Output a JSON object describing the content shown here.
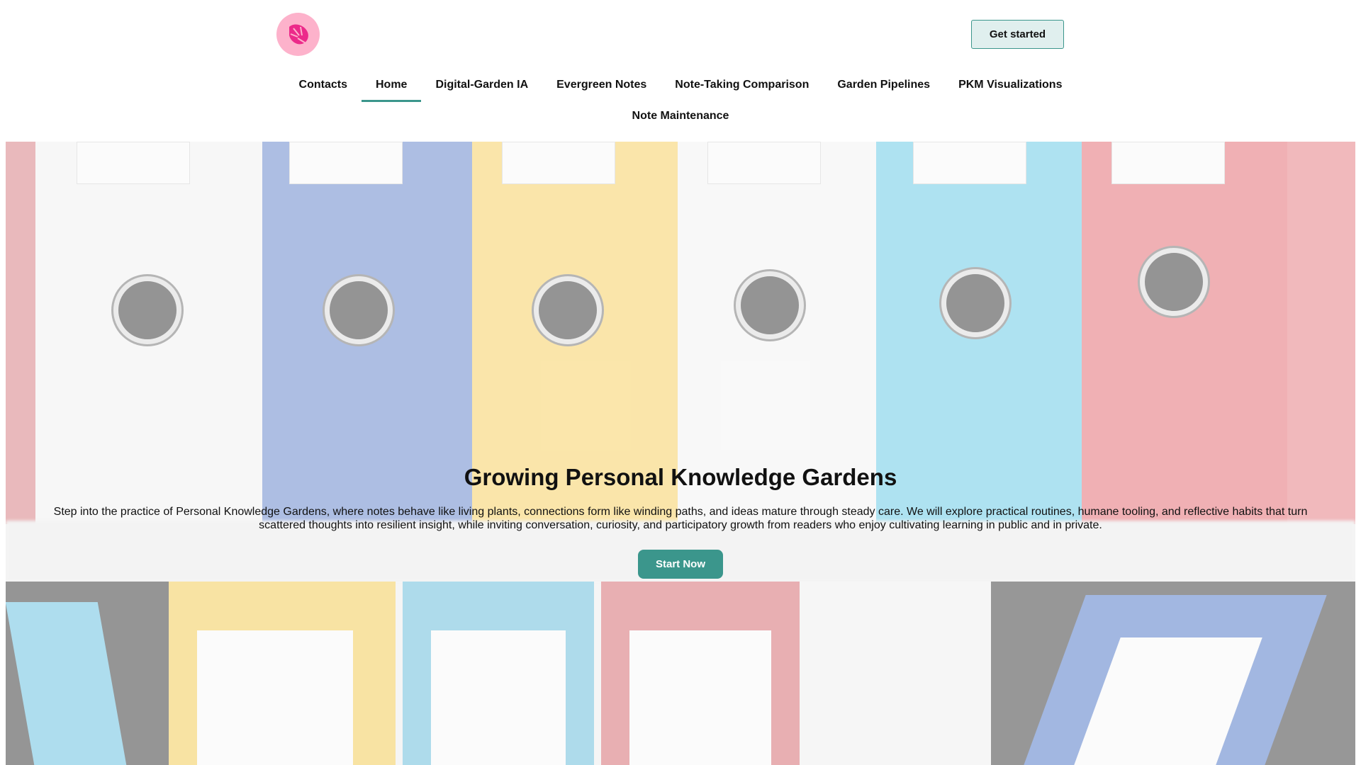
{
  "header": {
    "logo_icon": "monstera-leaf-icon",
    "cta_label": "Get started"
  },
  "nav": {
    "items": [
      {
        "label": "Contacts"
      },
      {
        "label": "Home",
        "active": true
      },
      {
        "label": "Digital-Garden IA"
      },
      {
        "label": "Evergreen Notes"
      },
      {
        "label": "Note-Taking Comparison"
      },
      {
        "label": "Garden Pipelines"
      },
      {
        "label": "PKM Visualizations"
      },
      {
        "label": "Note Maintenance"
      }
    ]
  },
  "hero": {
    "title": "Growing Personal Knowledge Gardens",
    "description": "Step into the practice of Personal Knowledge Gardens, where notes behave like living plants, connections form like winding paths, and ideas mature through steady care. We will explore practical routines, humane tooling, and reflective habits that turn scattered thoughts into resilient insight, while inviting conversation, curiosity, and participatory growth from readers who enjoy cultivating learning in public and in private.",
    "button_label": "Start Now"
  },
  "colors": {
    "accent": "#3b968c",
    "logo_bg": "#fdb2cb",
    "logo_leaf": "#ec2a8a"
  }
}
